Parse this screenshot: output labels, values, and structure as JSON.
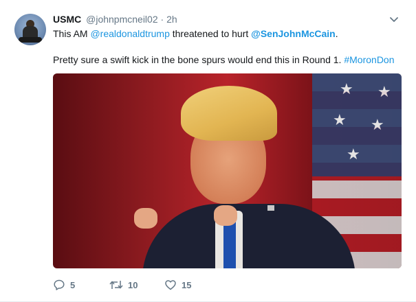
{
  "tweet": {
    "author_name": "USMC",
    "author_handle": "@johnpmcneil02",
    "separator": "·",
    "time": "2h",
    "text_line1_prefix": "This AM ",
    "mention_trump": "@realdonaldtrump",
    "text_line1_middle": " threatened to hurt ",
    "mention_mccain": "@SenJohnMcCain",
    "text_line1_suffix": ".",
    "text_line2": "Pretty sure a swift kick in the bone spurs would end this in Round 1. ",
    "hashtag": "#MoronDon",
    "actions": {
      "reply_count": "5",
      "retweet_count": "10",
      "like_count": "15"
    }
  },
  "icons": {
    "more": "chevron-down-icon",
    "reply": "reply-icon",
    "retweet": "retweet-icon",
    "like": "heart-icon"
  },
  "colors": {
    "link": "#1b95e0",
    "secondary_text": "#657786",
    "primary_text": "#14171a"
  }
}
